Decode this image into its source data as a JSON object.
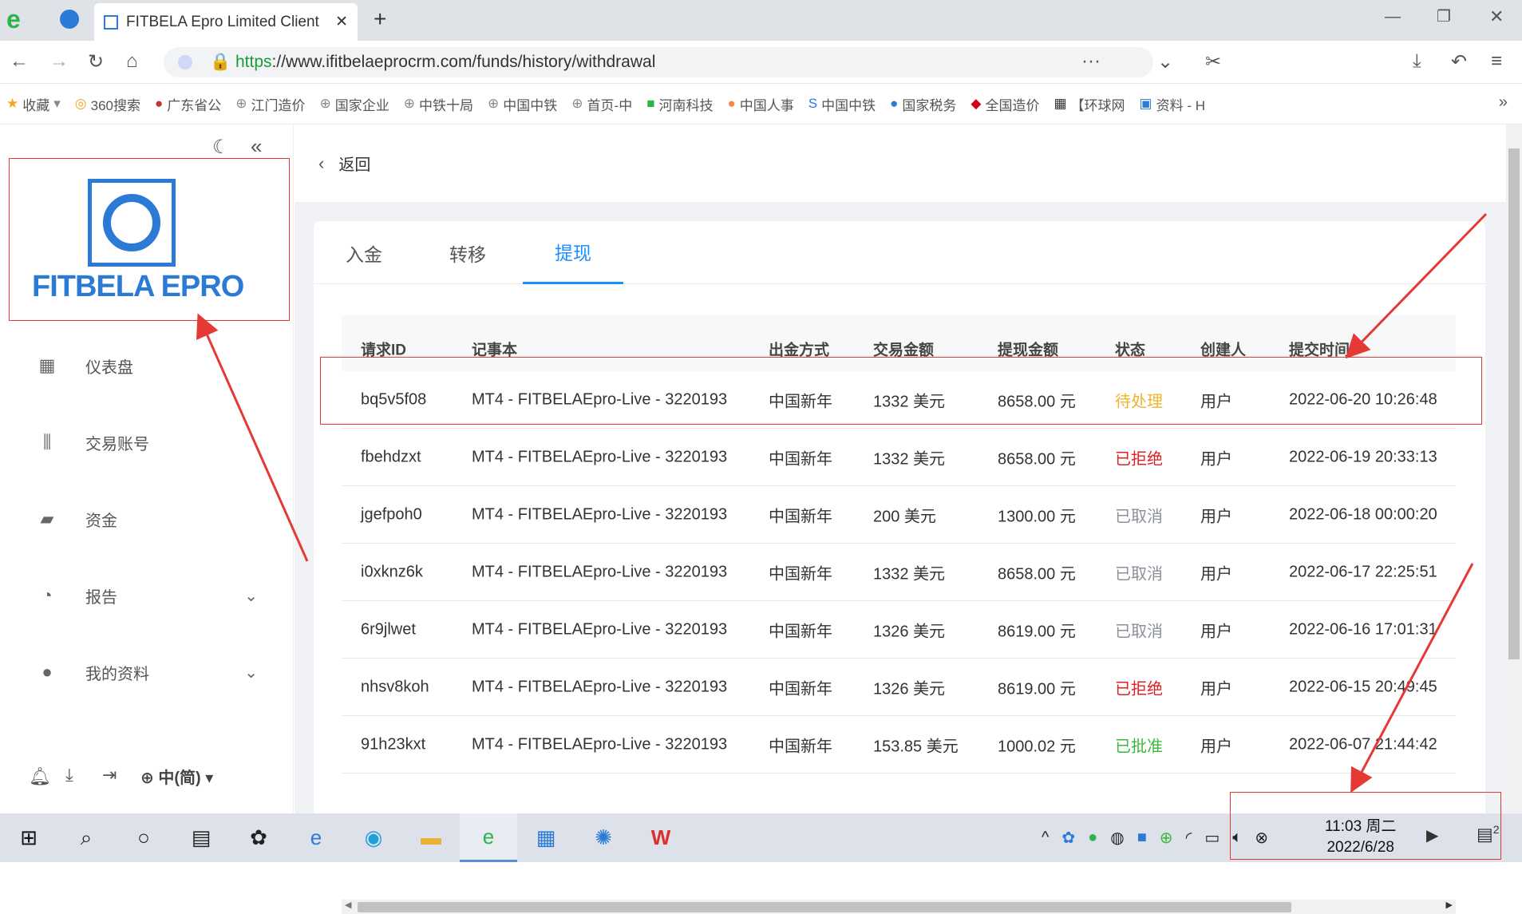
{
  "browser": {
    "tab_title": "FITBELA Epro Limited Client",
    "url_scheme": "https",
    "url_rest": "://www.ifitbelaeprocrm.com/funds/history/withdrawal"
  },
  "bookmarks": [
    "收藏",
    "360搜索",
    "广东省公",
    "江门造价",
    "国家企业",
    "中铁十局",
    "中国中铁",
    "首页-中",
    "河南科技",
    "中国人事",
    "中国中铁",
    "国家税务",
    "全国造价",
    "【环球网",
    "资料 - H"
  ],
  "sidebar": {
    "logo_text": "FITBELA EPRO",
    "items": [
      {
        "label": "仪表盘",
        "icon": "dashboard-icon"
      },
      {
        "label": "交易账号",
        "icon": "chart-icon"
      },
      {
        "label": "资金",
        "icon": "wallet-icon"
      },
      {
        "label": "报告",
        "icon": "pie-icon",
        "expand": true
      },
      {
        "label": "我的资料",
        "icon": "user-icon",
        "expand": true
      }
    ],
    "language": "中(简)"
  },
  "header": {
    "back_label": "返回"
  },
  "tabs": [
    "入金",
    "转移",
    "提现"
  ],
  "table": {
    "headers": [
      "请求ID",
      "记事本",
      "出金方式",
      "交易金额",
      "提现金额",
      "状态",
      "创建人",
      "提交时间"
    ],
    "rows": [
      [
        "bq5v5f08",
        "MT4 - FITBELAEpro-Live - 3220193",
        "中国新年",
        "1332 美元",
        "8658.00 元",
        "待处理",
        "用户",
        "2022-06-20 10:26:48"
      ],
      [
        "fbehdzxt",
        "MT4 - FITBELAEpro-Live - 3220193",
        "中国新年",
        "1332 美元",
        "8658.00 元",
        "已拒绝",
        "用户",
        "2022-06-19 20:33:13"
      ],
      [
        "jgefpoh0",
        "MT4 - FITBELAEpro-Live - 3220193",
        "中国新年",
        "200 美元",
        "1300.00 元",
        "已取消",
        "用户",
        "2022-06-18 00:00:20"
      ],
      [
        "i0xknz6k",
        "MT4 - FITBELAEpro-Live - 3220193",
        "中国新年",
        "1332 美元",
        "8658.00 元",
        "已取消",
        "用户",
        "2022-06-17 22:25:51"
      ],
      [
        "6r9jlwet",
        "MT4 - FITBELAEpro-Live - 3220193",
        "中国新年",
        "1326 美元",
        "8619.00 元",
        "已取消",
        "用户",
        "2022-06-16 17:01:31"
      ],
      [
        "nhsv8koh",
        "MT4 - FITBELAEpro-Live - 3220193",
        "中国新年",
        "1326 美元",
        "8619.00 元",
        "已拒绝",
        "用户",
        "2022-06-15 20:49:45"
      ],
      [
        "91h23kxt",
        "MT4 - FITBELAEpro-Live - 3220193",
        "中国新年",
        "153.85 美元",
        "1000.02 元",
        "已批准",
        "用户",
        "2022-06-07 21:44:42"
      ]
    ]
  },
  "status_colors": {
    "待处理": "#f0b429",
    "已拒绝": "#e02020",
    "已取消": "#8a8f99",
    "已批准": "#3cb83c"
  },
  "taskbar": {
    "time": "11:03 周二",
    "date": "2022/6/28",
    "notifications": "2"
  }
}
